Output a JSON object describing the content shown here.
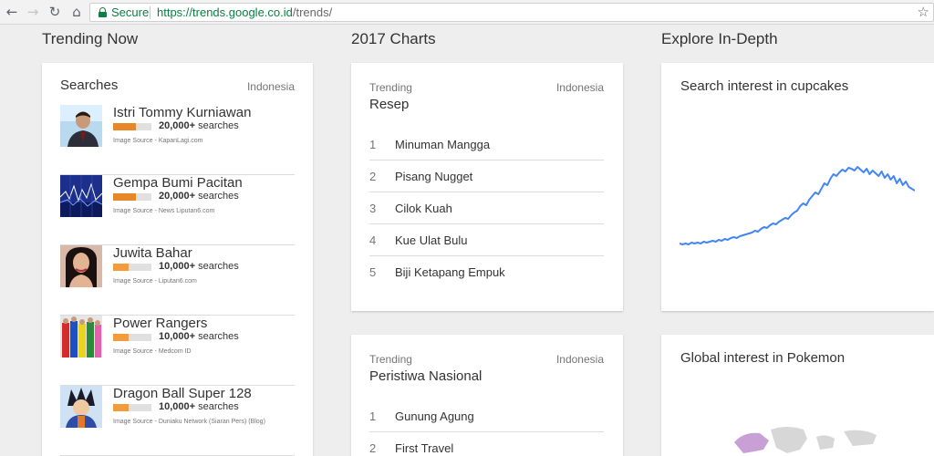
{
  "browser": {
    "secure_label": "Secure",
    "url_host": "https://trends.google.co.id",
    "url_path": "/trends/"
  },
  "sections": {
    "trending_now": "Trending Now",
    "charts_2017": "2017 Charts",
    "explore": "Explore In-Depth"
  },
  "searches": {
    "heading": "Searches",
    "region": "Indonesia",
    "suffix": "searches",
    "image_source_prefix": "Image Source - ",
    "items": [
      {
        "title": "Istri Tommy Kurniawan",
        "count": "20,000+",
        "source": "KapanLagi.com",
        "level": 0.6
      },
      {
        "title": "Gempa Bumi Pacitan",
        "count": "20,000+",
        "source": "News Liputan6.com",
        "level": 0.6
      },
      {
        "title": "Juwita Bahar",
        "count": "10,000+",
        "source": "Liputan6.com",
        "level": 0.4
      },
      {
        "title": "Power Rangers",
        "count": "10,000+",
        "source": "Medcom ID",
        "level": 0.4
      },
      {
        "title": "Dragon Ball Super 128",
        "count": "10,000+",
        "source": "Duniaku Network (Siaran Pers) (Blog)",
        "level": 0.4
      }
    ]
  },
  "charts": [
    {
      "label": "Trending",
      "region": "Indonesia",
      "title": "Resep",
      "items": [
        {
          "rank": "1",
          "name": "Minuman Mangga"
        },
        {
          "rank": "2",
          "name": "Pisang Nugget"
        },
        {
          "rank": "3",
          "name": "Cilok Kuah"
        },
        {
          "rank": "4",
          "name": "Kue Ulat Bulu"
        },
        {
          "rank": "5",
          "name": "Biji Ketapang Empuk"
        }
      ]
    },
    {
      "label": "Trending",
      "region": "Indonesia",
      "title": "Peristiwa Nasional",
      "items": [
        {
          "rank": "1",
          "name": "Gunung Agung"
        },
        {
          "rank": "2",
          "name": "First Travel"
        }
      ]
    }
  ],
  "explore": {
    "cupcakes_title": "Search interest in cupcakes",
    "pokemon_title": "Global interest in Pokemon",
    "line_color": "#4285f4",
    "cupcakes_series": [
      14,
      13,
      14,
      13,
      15,
      14,
      15,
      14,
      16,
      15,
      16,
      17,
      16,
      18,
      17,
      19,
      18,
      20,
      21,
      20,
      22,
      23,
      24,
      25,
      26,
      28,
      27,
      30,
      32,
      31,
      34,
      36,
      35,
      38,
      40,
      42,
      41,
      45,
      48,
      50,
      55,
      58,
      56,
      62,
      66,
      70,
      68,
      74,
      80,
      78,
      85,
      90,
      88,
      92,
      95,
      93,
      97,
      96,
      94,
      98,
      95,
      92,
      96,
      90,
      94,
      91,
      88,
      93,
      86,
      90,
      84,
      88,
      80,
      85,
      78,
      82,
      76,
      74,
      72
    ]
  }
}
